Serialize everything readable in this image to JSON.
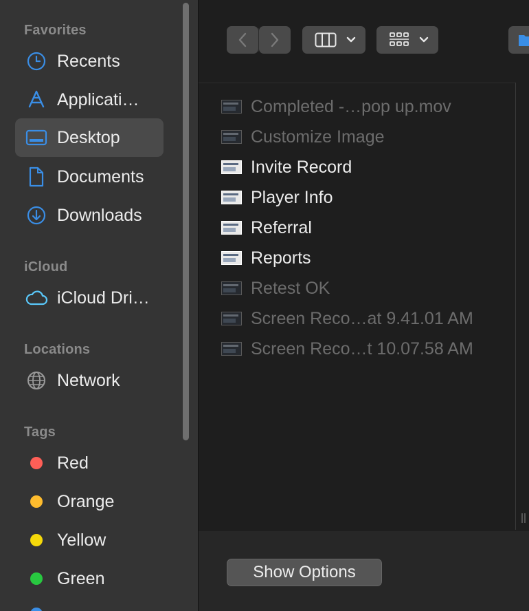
{
  "sidebar": {
    "sections": {
      "favorites": "Favorites",
      "icloud": "iCloud",
      "locations": "Locations",
      "tags": "Tags"
    },
    "favorites": [
      {
        "label": "Recents",
        "icon": "clock-icon"
      },
      {
        "label": "Applicati…",
        "icon": "applications-icon"
      },
      {
        "label": "Desktop",
        "icon": "desktop-icon",
        "selected": true
      },
      {
        "label": "Documents",
        "icon": "document-icon"
      },
      {
        "label": "Downloads",
        "icon": "download-icon"
      }
    ],
    "icloud": [
      {
        "label": "iCloud Dri…",
        "icon": "cloud-icon"
      }
    ],
    "locations": [
      {
        "label": "Network",
        "icon": "globe-icon"
      }
    ],
    "tags": [
      {
        "label": "Red",
        "color": "#ff5f57"
      },
      {
        "label": "Orange",
        "color": "#febc2e"
      },
      {
        "label": "Yellow",
        "color": "#f5d90a"
      },
      {
        "label": "Green",
        "color": "#28c840"
      }
    ]
  },
  "toolbar": {
    "back_icon": "chevron-left-icon",
    "forward_icon": "chevron-right-icon",
    "view_icon": "columns-view-icon",
    "group_icon": "grid-group-icon"
  },
  "files": [
    {
      "name": "Completed -…pop up.mov",
      "enabled": false
    },
    {
      "name": "Customize Image",
      "enabled": false
    },
    {
      "name": "Invite Record",
      "enabled": true
    },
    {
      "name": "Player Info",
      "enabled": true
    },
    {
      "name": "Referral",
      "enabled": true
    },
    {
      "name": "Reports",
      "enabled": true
    },
    {
      "name": "Retest OK",
      "enabled": false
    },
    {
      "name": "Screen Reco…at 9.41.01 AM",
      "enabled": false
    },
    {
      "name": "Screen Reco…t 10.07.58 AM",
      "enabled": false
    }
  ],
  "footer": {
    "show_options_label": "Show Options"
  },
  "colors": {
    "accent": "#3a8ee6"
  }
}
